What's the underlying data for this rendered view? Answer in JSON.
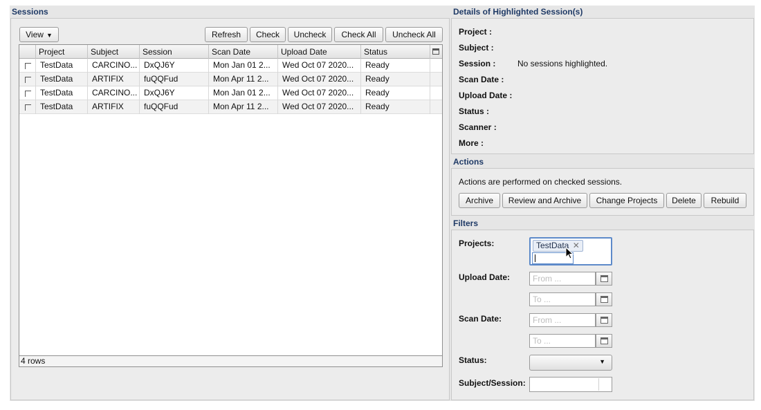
{
  "sessions": {
    "title": "Sessions",
    "view_label": "View",
    "buttons": {
      "refresh": "Refresh",
      "check": "Check",
      "uncheck": "Uncheck",
      "check_all": "Check All",
      "uncheck_all": "Uncheck All"
    },
    "columns": [
      "Project",
      "Subject",
      "Session",
      "Scan Date",
      "Upload Date",
      "Status"
    ],
    "rows": [
      [
        "TestData",
        "CARCINO...",
        "DxQJ6Y",
        "Mon Jan 01 2...",
        "Wed Oct 07 2020...",
        "Ready"
      ],
      [
        "TestData",
        "ARTIFIX",
        "fuQQFud",
        "Mon Apr 11 2...",
        "Wed Oct 07 2020...",
        "Ready"
      ],
      [
        "TestData",
        "CARCINO...",
        "DxQJ6Y",
        "Mon Jan 01 2...",
        "Wed Oct 07 2020...",
        "Ready"
      ],
      [
        "TestData",
        "ARTIFIX",
        "fuQQFud",
        "Mon Apr 11 2...",
        "Wed Oct 07 2020...",
        "Ready"
      ]
    ],
    "row_count": "4 rows"
  },
  "details": {
    "title": "Details of Highlighted Session(s)",
    "labels": {
      "project": "Project :",
      "subject": "Subject :",
      "session": "Session :",
      "scan_date": "Scan Date :",
      "upload_date": "Upload Date :",
      "status": "Status :",
      "scanner": "Scanner :",
      "more": "More :"
    },
    "session_value": "No sessions highlighted."
  },
  "actions": {
    "title": "Actions",
    "description": "Actions are performed on checked sessions.",
    "buttons": {
      "archive": "Archive",
      "review_archive": "Review and Archive",
      "change_projects": "Change Projects",
      "delete": "Delete",
      "rebuild": "Rebuild"
    }
  },
  "filters": {
    "title": "Filters",
    "projects_label": "Projects:",
    "project_tag": "TestData",
    "tag_remove_glyph": "✕",
    "upload_date_label": "Upload Date:",
    "scan_date_label": "Scan Date:",
    "from_placeholder": "From ...",
    "to_placeholder": "To ...",
    "status_label": "Status:",
    "subject_session_label": "Subject/Session:"
  }
}
